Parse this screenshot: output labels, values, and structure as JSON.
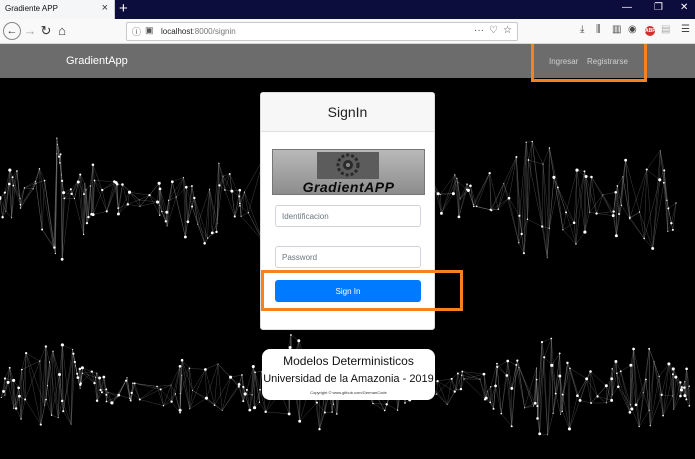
{
  "browser": {
    "tab_title": "Gradiente APP",
    "tab_close": "×",
    "new_tab": "+",
    "url_host": "localhost",
    "url_rest": ":8000/signin",
    "url_more": "···",
    "window_controls": [
      "—",
      "❐",
      "✕"
    ]
  },
  "app": {
    "brand": "GradientApp",
    "nav_links": [
      "Ingresar",
      "Registrarse"
    ]
  },
  "signin": {
    "title": "SignIn",
    "logo_text": "GradientAPP",
    "id_placeholder": "Identificacion",
    "password_placeholder": "Password",
    "button_label": "Sign In"
  },
  "footer": {
    "title": "Modelos Deterministicos",
    "subtitle": "Universidad de la Amazonia - 2019",
    "copyright": "Copyright © www.github.com/GermanCode"
  },
  "colors": {
    "highlight": "#f58220",
    "primary": "#007bff",
    "navbar": "#6c6c6c"
  },
  "icons": [
    "back-arrow-icon",
    "forward-arrow-icon",
    "reload-icon",
    "home-icon",
    "info-icon",
    "lock-icon",
    "pocket-icon",
    "star-icon",
    "download-icon",
    "library-icon",
    "reader-icon",
    "account-icon",
    "adblock-icon",
    "page-icon",
    "menu-icon",
    "gear-icon"
  ]
}
